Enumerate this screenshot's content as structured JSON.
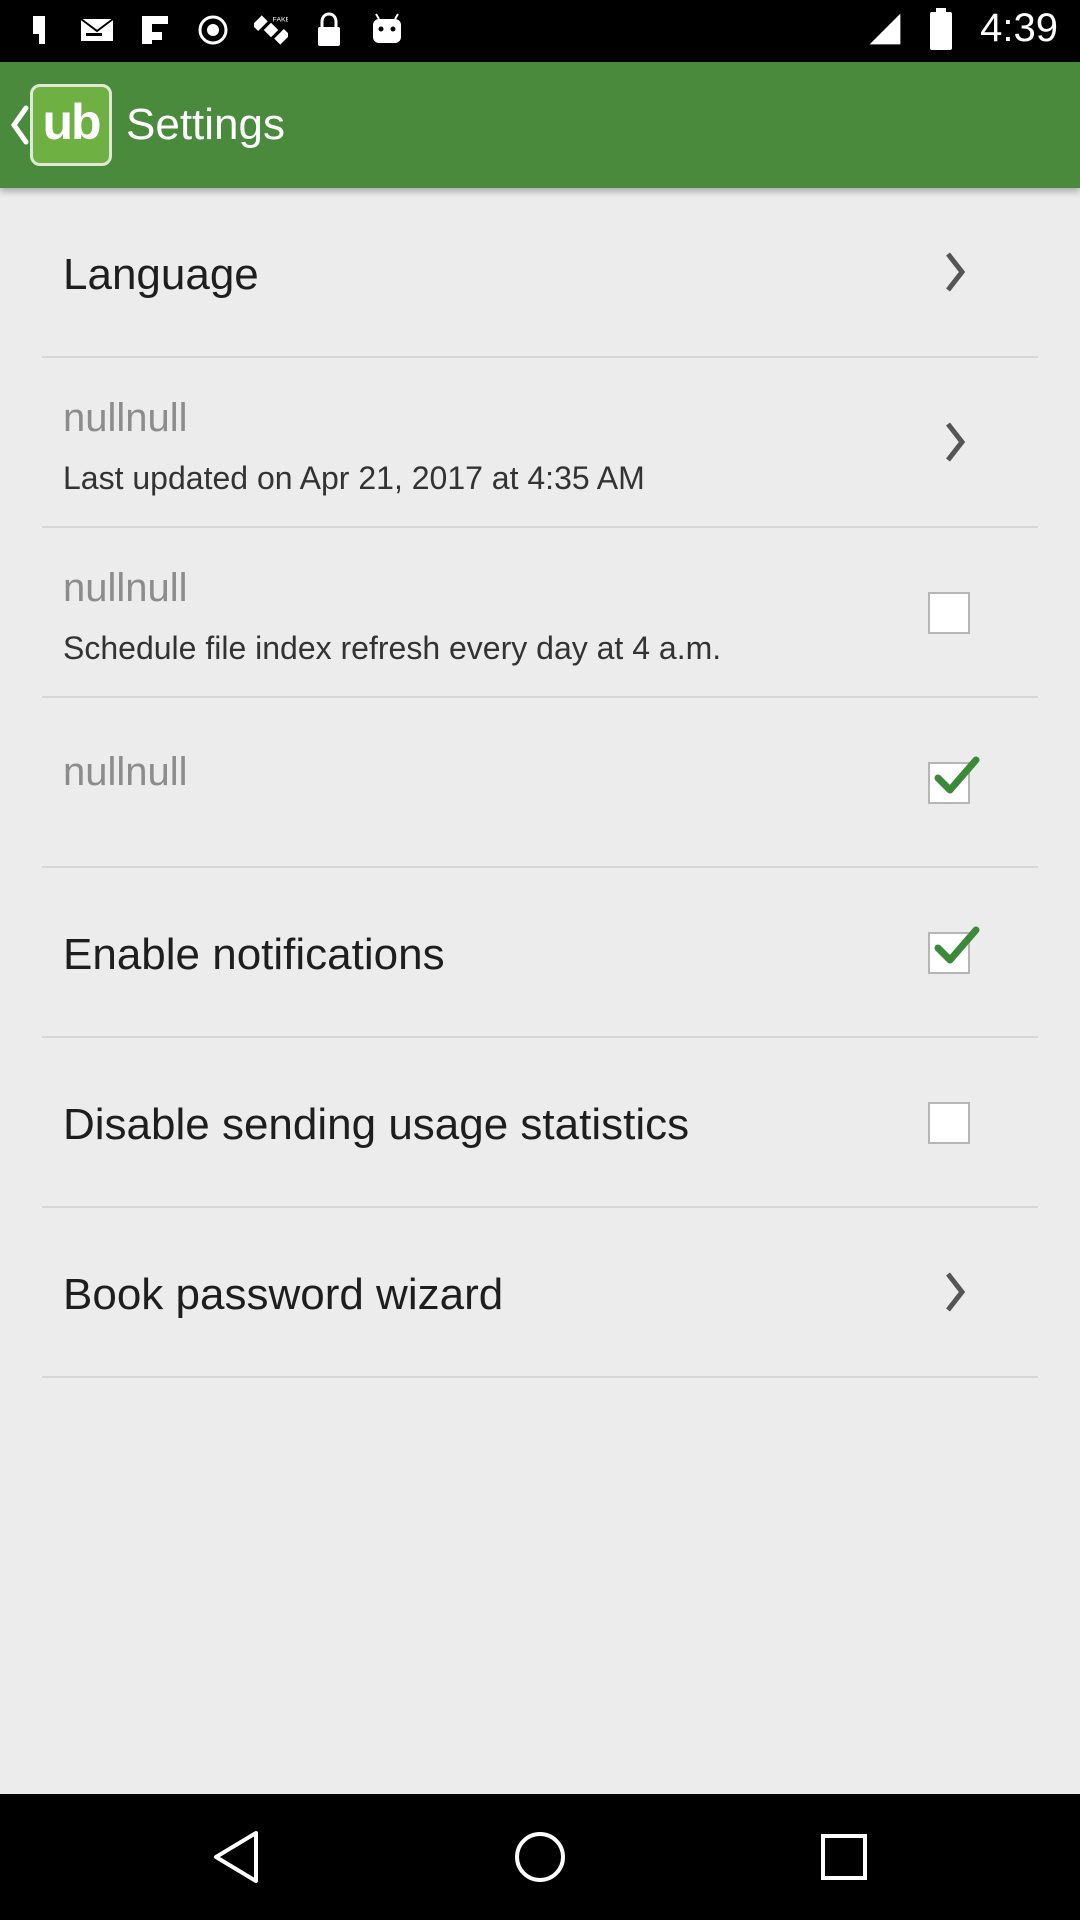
{
  "status_bar": {
    "time": "4:39",
    "icons": [
      "whatsapp-icon",
      "mail-icon",
      "flipboard-icon",
      "sync-icon",
      "satellite-icon",
      "lock-icon",
      "android-icon",
      "signal-icon",
      "battery-icon"
    ]
  },
  "app_bar": {
    "logo_text": "ub",
    "title": "Settings",
    "accent_color": "#4a8a3c"
  },
  "settings": {
    "language": {
      "title": "Language",
      "control": "chevron-right-icon"
    },
    "last_updated": {
      "title": "nullnull",
      "subtitle": "Last updated on Apr 21, 2017 at 4:35 AM",
      "control": "chevron-right-icon"
    },
    "schedule_refresh": {
      "title": "nullnull",
      "subtitle": "Schedule file index refresh every day at 4 a.m.",
      "checked": false
    },
    "nullnull_option": {
      "title": "nullnull",
      "checked": true
    },
    "enable_notifications": {
      "title": "Enable notifications",
      "checked": true
    },
    "disable_statistics": {
      "title": "Disable sending usage statistics",
      "checked": false
    },
    "book_password": {
      "title": "Book password wizard",
      "control": "chevron-right-icon"
    }
  },
  "nav_bar": {
    "buttons": [
      "back-icon",
      "home-icon",
      "recents-icon"
    ]
  }
}
